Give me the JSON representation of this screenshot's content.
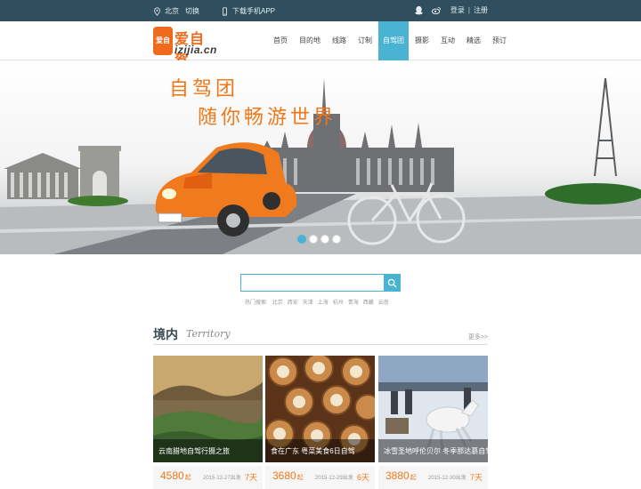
{
  "topbar": {
    "city": "北京",
    "switch": "切换",
    "app": "下载手机APP",
    "login": "登录",
    "divider": "|",
    "register": "注册"
  },
  "logo": {
    "mark": "爱自驾",
    "name": "爱自驾",
    "domain": "izijia.cn"
  },
  "nav": [
    {
      "label": "首页"
    },
    {
      "label": "目的地"
    },
    {
      "label": "线路"
    },
    {
      "label": "订制"
    },
    {
      "label": "自驾团",
      "active": true
    },
    {
      "label": "摄影"
    },
    {
      "label": "互动"
    },
    {
      "label": "精选"
    },
    {
      "label": "预订"
    }
  ],
  "banner": {
    "slogan1": "自驾团",
    "slogan2": "随你畅游世界",
    "slide_count": 4,
    "active_slide": 1
  },
  "search": {
    "placeholder": "",
    "hot_label": "热门搜索:",
    "hot_terms": [
      "北京",
      "西安",
      "天津",
      "上海",
      "杭州",
      "青海",
      "西藏",
      "云南"
    ]
  },
  "section": {
    "title_zh": "境内",
    "title_en": "Territory",
    "more": "更多>>"
  },
  "cards": [
    {
      "caption": "云南腊地自驾行摄之旅",
      "price": "4580",
      "unit": "起",
      "date": "2015-12-27出发",
      "days": "7天"
    },
    {
      "caption": "食在广东 粤菜美食6日自驾",
      "price": "3680",
      "unit": "起",
      "date": "2015-12-29出发",
      "days": "6天"
    },
    {
      "caption": "冰雪圣地呼伦贝尔 冬季那达慕自驾",
      "price": "3880",
      "unit": "起",
      "date": "2015-12-30出发",
      "days": "7天"
    }
  ],
  "colors": {
    "topbar": "#2f4f5e",
    "accent": "#4ab2d3",
    "orange": "#f07818"
  }
}
